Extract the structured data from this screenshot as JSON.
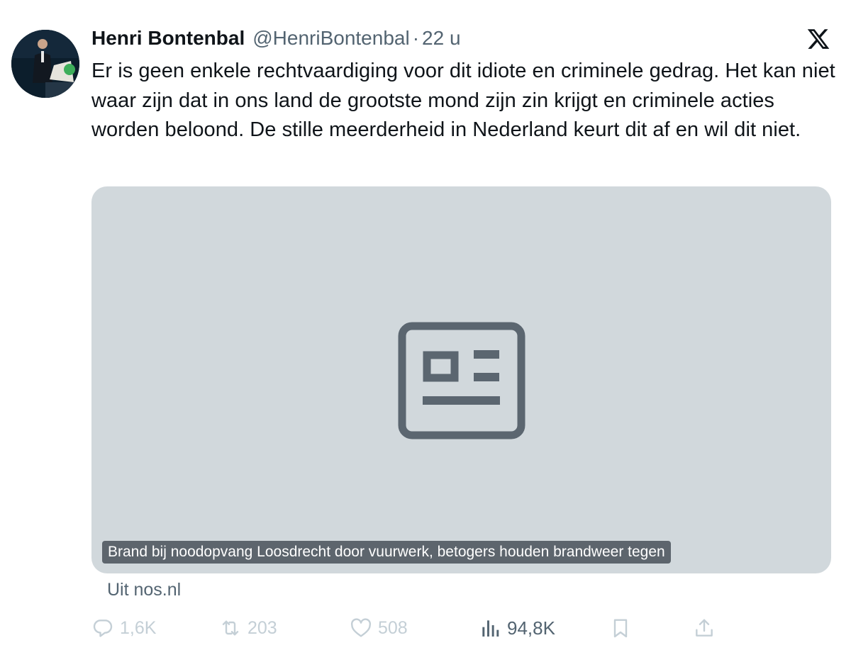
{
  "tweet": {
    "author": {
      "display_name": "Henri Bontenbal",
      "handle": "@HenriBontenbal",
      "separator": "·",
      "time": "22 u"
    },
    "text": "Er is geen enkele rechtvaardiging voor dit idiote en criminele gedrag. Het kan niet waar zijn dat in ons land de grootste mond zijn zin krijgt en criminele acties worden beloond. De stille meerderheid in Nederland keurt dit af en wil dit niet.",
    "card": {
      "caption": "Brand bij noodopvang Loosdrecht door vuurwerk, betogers houden brandweer tegen",
      "source": "Uit nos.nl",
      "icon": "news-article-icon"
    },
    "actions": {
      "reply": {
        "icon": "reply-icon",
        "count": "1,6K"
      },
      "retweet": {
        "icon": "retweet-icon",
        "count": "203"
      },
      "like": {
        "icon": "heart-icon",
        "count": "508"
      },
      "views": {
        "icon": "views-chart-icon",
        "count": "94,8K"
      },
      "bookmark": {
        "icon": "bookmark-icon"
      },
      "share": {
        "icon": "share-icon"
      }
    },
    "platform_logo": "x-logo-icon"
  },
  "colors": {
    "text_primary": "#0f1419",
    "text_secondary": "#536471",
    "card_background": "#d1d8dc",
    "card_icon": "#5b6670",
    "action_faded": "#c4cfd6"
  }
}
